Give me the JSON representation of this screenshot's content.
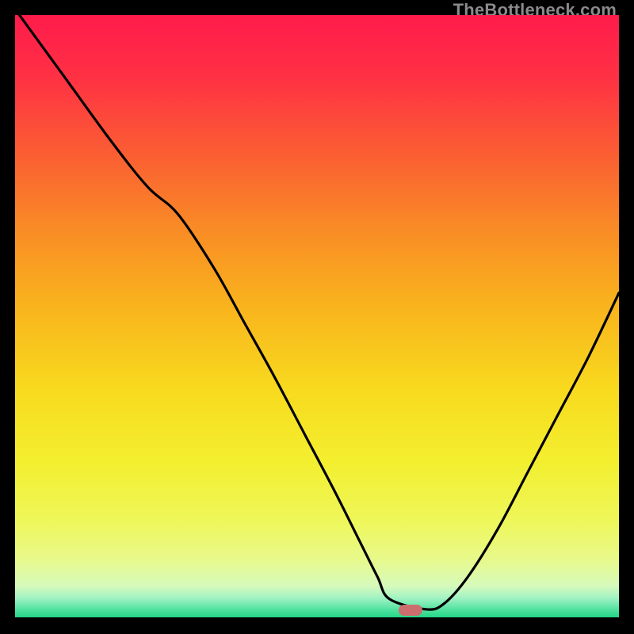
{
  "watermark": {
    "text": "TheBottleneck.com"
  },
  "gradient": {
    "stops": [
      {
        "offset": 0.0,
        "color": "#ff1b4b"
      },
      {
        "offset": 0.1,
        "color": "#ff3044"
      },
      {
        "offset": 0.22,
        "color": "#fb5a34"
      },
      {
        "offset": 0.35,
        "color": "#f98a26"
      },
      {
        "offset": 0.48,
        "color": "#f9b31d"
      },
      {
        "offset": 0.62,
        "color": "#f8da1e"
      },
      {
        "offset": 0.74,
        "color": "#f3ef2f"
      },
      {
        "offset": 0.84,
        "color": "#eef75b"
      },
      {
        "offset": 0.9,
        "color": "#e8f98a"
      },
      {
        "offset": 0.945,
        "color": "#d6fabb"
      },
      {
        "offset": 0.965,
        "color": "#a3f3c4"
      },
      {
        "offset": 0.985,
        "color": "#4fe29f"
      },
      {
        "offset": 1.0,
        "color": "#19d483"
      }
    ]
  },
  "marker": {
    "color": "#cb6e6d",
    "x_frac": 0.655,
    "y_frac": 0.985
  },
  "chart_data": {
    "type": "line",
    "title": "",
    "xlabel": "",
    "ylabel": "",
    "xlim": [
      0,
      100
    ],
    "ylim": [
      0,
      100
    ],
    "grid": false,
    "series": [
      {
        "name": "bottleneck-curve",
        "x": [
          0,
          8,
          16,
          22,
          27,
          33,
          38,
          43,
          48,
          53,
          57,
          60,
          62,
          68,
          71,
          75,
          80,
          85,
          90,
          95,
          100
        ],
        "y": [
          101,
          90,
          79,
          71.5,
          67,
          58,
          49,
          40,
          30.5,
          21,
          13,
          7,
          3.3,
          1.6,
          2.5,
          7,
          15,
          24.5,
          34,
          43.5,
          54
        ]
      }
    ],
    "annotations": [
      {
        "type": "marker",
        "shape": "pill",
        "x": 65.5,
        "y": 1.5,
        "color": "#cb6e6d"
      }
    ],
    "background": {
      "type": "vertical-gradient",
      "description": "red (top) through orange, yellow, pale yellow-green to green (bottom)"
    }
  }
}
